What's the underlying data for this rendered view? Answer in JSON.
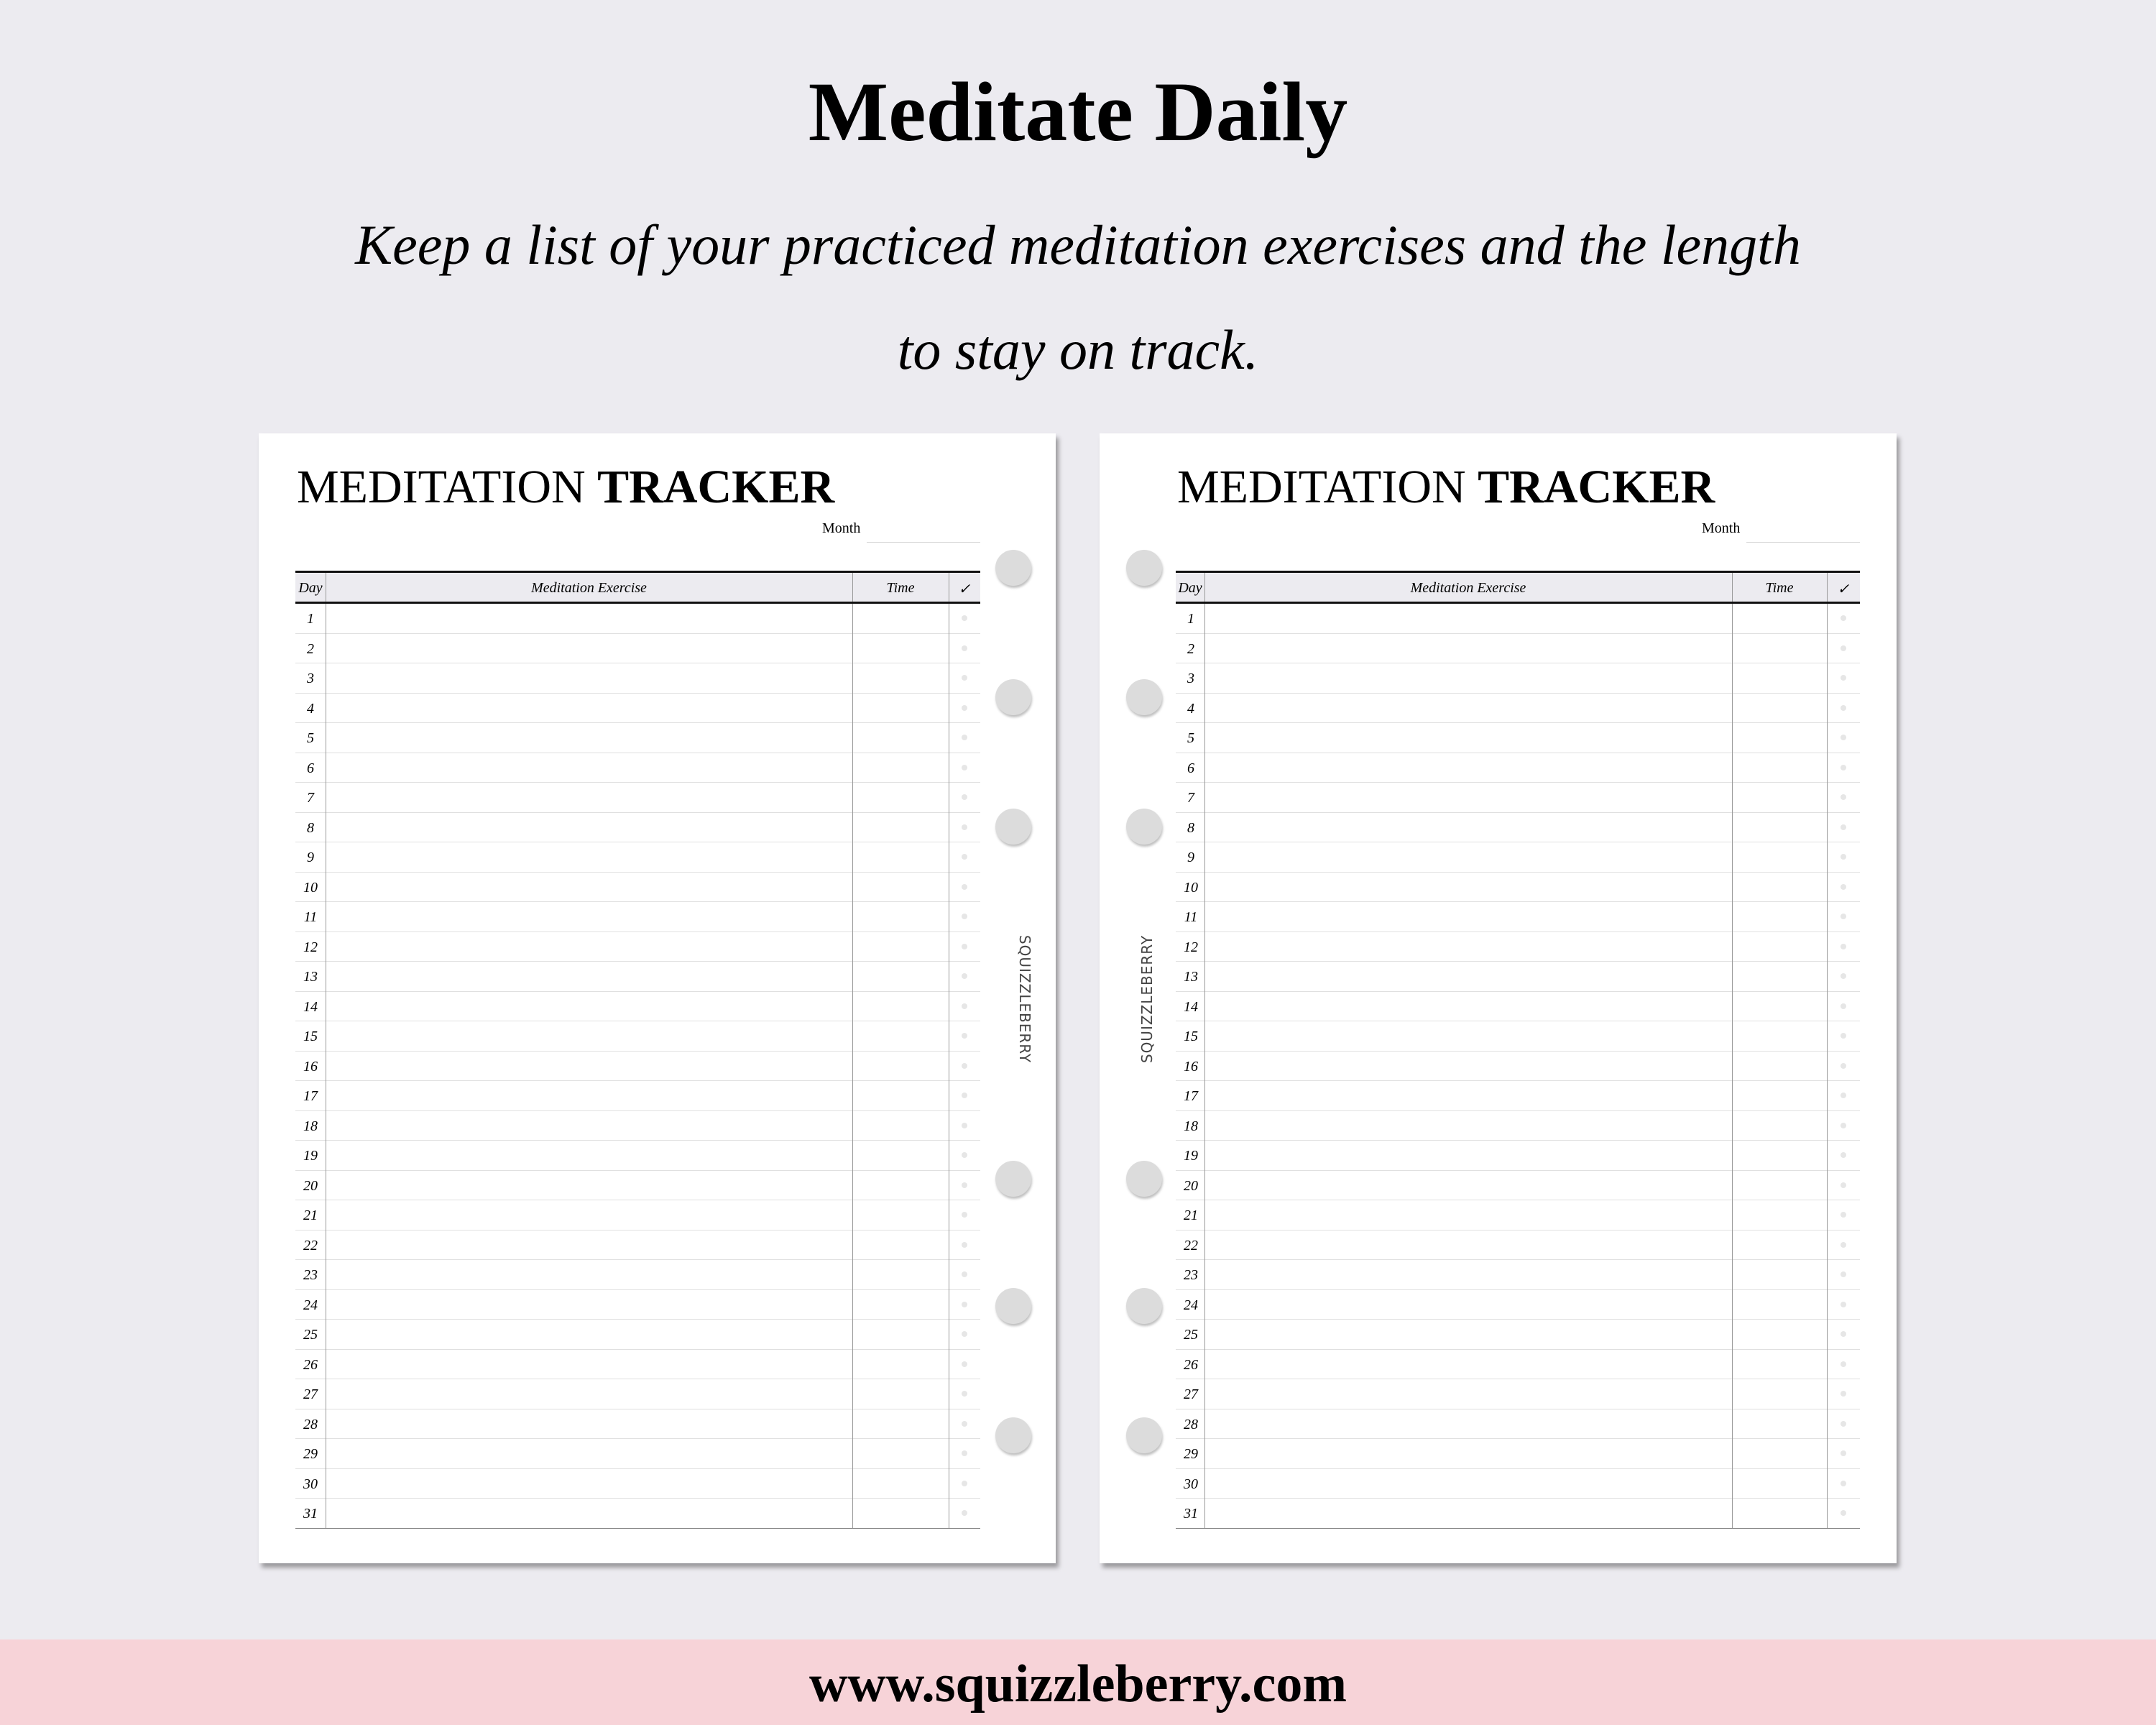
{
  "header": {
    "title": "Meditate Daily",
    "subtitle_line1": "Keep a list of your practiced meditation exercises and the length",
    "subtitle_line2": "to stay on track."
  },
  "planner": {
    "title_light": "MEDITATION",
    "title_bold": "TRACKER",
    "month_label": "Month",
    "columns": {
      "day": "Day",
      "exercise": "Meditation Exercise",
      "time": "Time",
      "check": "✓"
    },
    "days": [
      "1",
      "2",
      "3",
      "4",
      "5",
      "6",
      "7",
      "8",
      "9",
      "10",
      "11",
      "12",
      "13",
      "14",
      "15",
      "16",
      "17",
      "18",
      "19",
      "20",
      "21",
      "22",
      "23",
      "24",
      "25",
      "26",
      "27",
      "28",
      "29",
      "30",
      "31"
    ],
    "brand": "SQUIZZLEBERRY"
  },
  "footer": {
    "url": "www.squizzleberry.com",
    "color": "#f7d3d8"
  }
}
